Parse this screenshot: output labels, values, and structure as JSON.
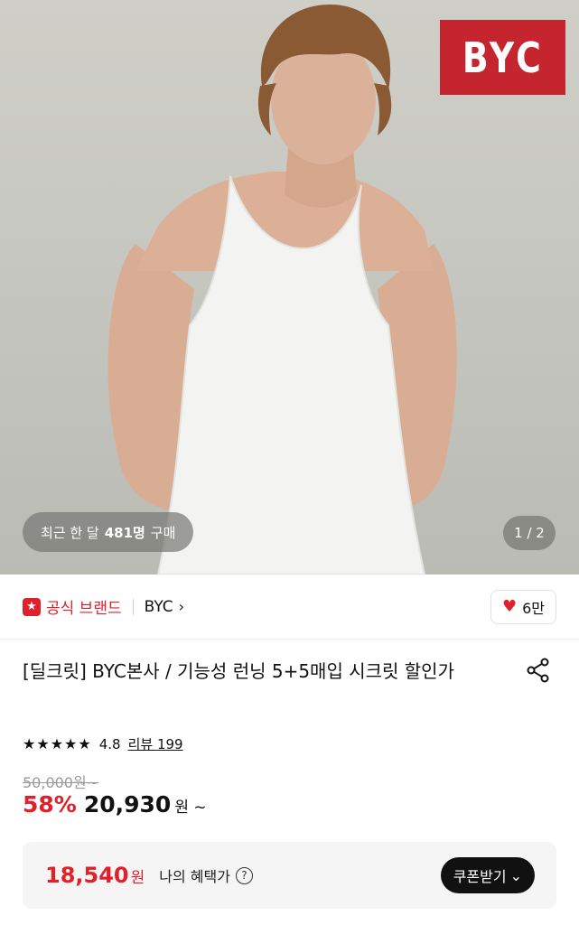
{
  "hero": {
    "brand_logo_text": "BYC",
    "purchase_prefix": "최근 한 달",
    "purchase_count": "481명",
    "purchase_suffix": "구매",
    "page_indicator": "1 / 2",
    "background_color": "#c9c9c2",
    "logo_color": "#c4252e"
  },
  "brand_row": {
    "official_label": "공식 브랜드",
    "official_icon": "star-badge-icon",
    "brand_name": "BYC",
    "brand_chevron": "›",
    "like_icon": "heart-icon",
    "like_count": "6만"
  },
  "product": {
    "title": "[딜크릿] BYC본사 / 기능성 런닝 5+5매입 시크릿 할인가",
    "share_icon": "share-icon",
    "stars": "★★★★★",
    "rating": "4.8",
    "review_label": "리뷰 199",
    "original_price": "50,000원~",
    "discount_rate": "58%",
    "sale_price": "20,930",
    "sale_unit": "원 ~"
  },
  "benefit": {
    "price": "18,540",
    "price_unit": "원",
    "label": "나의 혜택가",
    "help_icon": "?",
    "coupon_label": "쿠폰받기",
    "coupon_chevron": "⌄"
  },
  "colors": {
    "accent_red": "#e0202a",
    "text_dark": "#111111",
    "muted_gray": "#9a9a9a"
  }
}
